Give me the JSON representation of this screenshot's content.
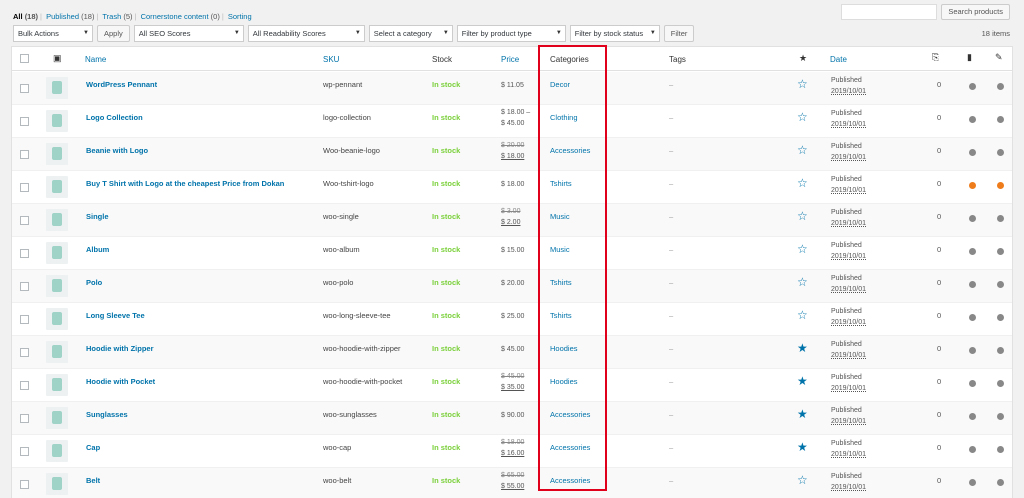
{
  "views": [
    {
      "label": "All",
      "count": "(18)",
      "current": true
    },
    {
      "label": "Published",
      "count": "(18)"
    },
    {
      "label": "Trash",
      "count": "(5)"
    },
    {
      "label": "Cornerstone content",
      "count": "(0)"
    },
    {
      "label": "Sorting",
      "count": ""
    }
  ],
  "search": {
    "button": "Search products",
    "value": ""
  },
  "toolbar": {
    "bulk_actions": "Bulk Actions",
    "apply": "Apply",
    "seo": "All SEO Scores",
    "readability": "All Readability Scores",
    "category": "Select a category",
    "product_type": "Filter by product type",
    "stock_status": "Filter by stock status",
    "filter": "Filter",
    "items_count": "18 items"
  },
  "columns": {
    "name": "Name",
    "sku": "SKU",
    "stock": "Stock",
    "price": "Price",
    "categories": "Categories",
    "tags": "Tags",
    "featured": "★",
    "date": "Date"
  },
  "rows": [
    {
      "name": "WordPress Pennant",
      "sku": "wp-pennant",
      "stock": "In stock",
      "price": "$ 11.05",
      "price2": "",
      "price_style": "plain",
      "category": "Decor",
      "tags": "–",
      "featured": "☆",
      "status": "Published",
      "date": "2019/10/01",
      "links": "0",
      "dot1": "#888888",
      "dot2": "#888888"
    },
    {
      "name": "Logo Collection",
      "sku": "logo-collection",
      "stock": "In stock",
      "price": "$ 18.00 –",
      "price2": "$ 45.00",
      "price_style": "range",
      "category": "Clothing",
      "tags": "–",
      "featured": "☆",
      "status": "Published",
      "date": "2019/10/01",
      "links": "0",
      "dot1": "#888888",
      "dot2": "#888888"
    },
    {
      "name": "Beanie with Logo",
      "sku": "Woo-beanie-logo",
      "stock": "In stock",
      "price": "$ 20.00",
      "price2": "$ 18.00",
      "price_style": "sale",
      "category": "Accessories",
      "tags": "–",
      "featured": "☆",
      "status": "Published",
      "date": "2019/10/01",
      "links": "0",
      "dot1": "#888888",
      "dot2": "#888888"
    },
    {
      "name": "Buy T Shirt with Logo at the cheapest Price from Dokan",
      "sku": "Woo-tshirt-logo",
      "stock": "In stock",
      "price": "$ 18.00",
      "price2": "",
      "price_style": "plain",
      "category": "Tshirts",
      "tags": "–",
      "featured": "☆",
      "status": "Published",
      "date": "2019/10/01",
      "links": "0",
      "dot1": "#ee7c1b",
      "dot2": "#ee7c1b"
    },
    {
      "name": "Single",
      "sku": "woo-single",
      "stock": "In stock",
      "price": "$ 3.00",
      "price2": "$ 2.00",
      "price_style": "sale",
      "category": "Music",
      "tags": "–",
      "featured": "☆",
      "status": "Published",
      "date": "2019/10/01",
      "links": "0",
      "dot1": "#888888",
      "dot2": "#888888"
    },
    {
      "name": "Album",
      "sku": "woo-album",
      "stock": "In stock",
      "price": "$ 15.00",
      "price2": "",
      "price_style": "plain",
      "category": "Music",
      "tags": "–",
      "featured": "☆",
      "status": "Published",
      "date": "2019/10/01",
      "links": "0",
      "dot1": "#888888",
      "dot2": "#888888"
    },
    {
      "name": "Polo",
      "sku": "woo-polo",
      "stock": "In stock",
      "price": "$ 20.00",
      "price2": "",
      "price_style": "plain",
      "category": "Tshirts",
      "tags": "–",
      "featured": "☆",
      "status": "Published",
      "date": "2019/10/01",
      "links": "0",
      "dot1": "#888888",
      "dot2": "#888888"
    },
    {
      "name": "Long Sleeve Tee",
      "sku": "woo-long-sleeve-tee",
      "stock": "In stock",
      "price": "$ 25.00",
      "price2": "",
      "price_style": "plain",
      "category": "Tshirts",
      "tags": "–",
      "featured": "☆",
      "status": "Published",
      "date": "2019/10/01",
      "links": "0",
      "dot1": "#888888",
      "dot2": "#888888"
    },
    {
      "name": "Hoodie with Zipper",
      "sku": "woo-hoodie-with-zipper",
      "stock": "In stock",
      "price": "$ 45.00",
      "price2": "",
      "price_style": "plain",
      "category": "Hoodies",
      "tags": "–",
      "featured": "★",
      "status": "Published",
      "date": "2019/10/01",
      "links": "0",
      "dot1": "#888888",
      "dot2": "#888888"
    },
    {
      "name": "Hoodie with Pocket",
      "sku": "woo-hoodie-with-pocket",
      "stock": "In stock",
      "price": "$ 45.00",
      "price2": "$ 35.00",
      "price_style": "sale",
      "category": "Hoodies",
      "tags": "–",
      "featured": "★",
      "status": "Published",
      "date": "2019/10/01",
      "links": "0",
      "dot1": "#888888",
      "dot2": "#888888"
    },
    {
      "name": "Sunglasses",
      "sku": "woo-sunglasses",
      "stock": "In stock",
      "price": "$ 90.00",
      "price2": "",
      "price_style": "plain",
      "category": "Accessories",
      "tags": "–",
      "featured": "★",
      "status": "Published",
      "date": "2019/10/01",
      "links": "0",
      "dot1": "#888888",
      "dot2": "#888888"
    },
    {
      "name": "Cap",
      "sku": "woo-cap",
      "stock": "In stock",
      "price": "$ 18.00",
      "price2": "$ 16.00",
      "price_style": "sale",
      "category": "Accessories",
      "tags": "–",
      "featured": "★",
      "status": "Published",
      "date": "2019/10/01",
      "links": "0",
      "dot1": "#888888",
      "dot2": "#888888"
    },
    {
      "name": "Belt",
      "sku": "woo-belt",
      "stock": "In stock",
      "price": "$ 65.00",
      "price2": "$ 55.00",
      "price_style": "sale",
      "category": "Accessories",
      "tags": "–",
      "featured": "☆",
      "status": "Published",
      "date": "2019/10/01",
      "links": "0",
      "dot1": "#888888",
      "dot2": "#888888"
    }
  ]
}
